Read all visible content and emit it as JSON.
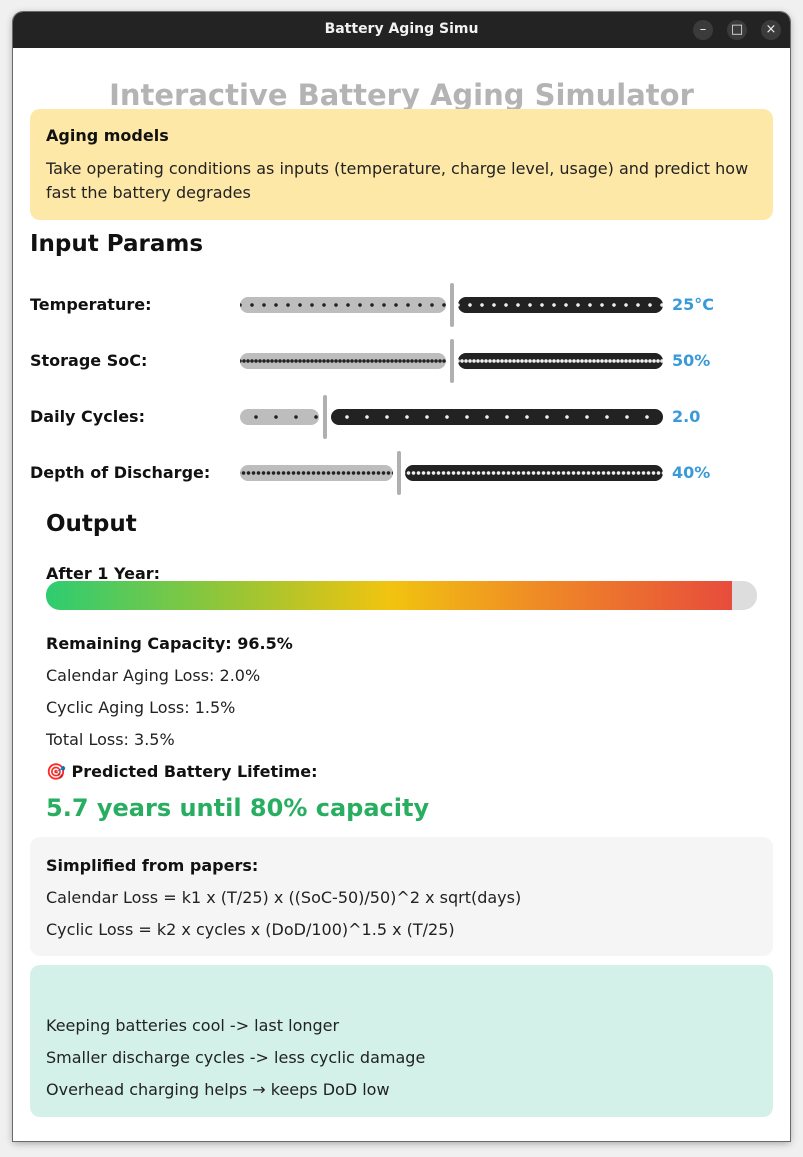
{
  "window": {
    "title": "Battery Aging Simu",
    "minimize_label": "–",
    "maximize_label": "□",
    "close_label": "×"
  },
  "page_title": "Interactive Battery Aging Simulator",
  "notice": {
    "heading": "Aging models",
    "body": "Take operating conditions as inputs (temperature, charge level, usage) and predict how fast the battery degrades"
  },
  "inputs": {
    "title": "Input Params",
    "params": [
      {
        "label": "Temperature:",
        "value": "25°C",
        "level": 0.5
      },
      {
        "label": "Storage SoC:",
        "value": "50%",
        "level": 0.5
      },
      {
        "label": "Daily Cycles:",
        "value": "2.0",
        "level": 0.2
      },
      {
        "label": "Depth of Discharge:",
        "value": "40%",
        "level": 0.375
      }
    ]
  },
  "output": {
    "title": "Output",
    "period": "After 1 Year:",
    "remaining_fraction": 0.965,
    "remaining": "Remaining Capacity: 96.5%",
    "calendar_loss": "Calendar Aging Loss: 2.0%",
    "cyclic_loss": "Cyclic Aging Loss: 1.5%",
    "total_loss": "Total Loss: 3.5%",
    "lifetime_icon": "🎯",
    "lifetime_label": "Predicted Battery Lifetime:",
    "lifetime_value": "5.7 years until 80% capacity"
  },
  "formulas": {
    "heading": "Simplified from papers:",
    "calendar": "Calendar Loss = k1 x (T/25) x ((SoC-50)/50)^2 x sqrt(days)",
    "cyclic": "Cyclic Loss = k2 x cycles x (DoD/100)^1.5 x (T/25)"
  },
  "tips": [
    "Keeping batteries cool -> last longer",
    "Smaller discharge cycles -> less cyclic damage",
    "Overhead charging helps → keeps DoD low"
  ],
  "colors": {
    "accent": "#3a9ad9",
    "lifetime_green": "#27ae60",
    "notice_bg": "#fde8a8",
    "tips_bg": "#d3f1e9"
  }
}
